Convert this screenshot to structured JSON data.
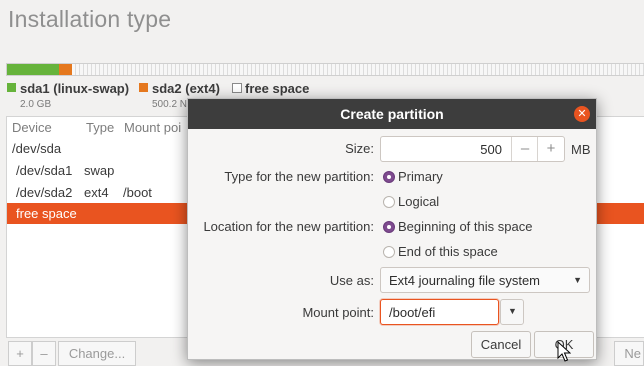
{
  "page_title": "Installation type",
  "disk": {
    "legend": [
      {
        "label": "sda1 (linux-swap)",
        "size": "2.0 GB",
        "color": "#66b33b"
      },
      {
        "label": "sda2 (ext4)",
        "size": "500.2 N",
        "color": "#e5781e"
      },
      {
        "label": "free space",
        "size": "",
        "color": "#ffffff"
      }
    ]
  },
  "table": {
    "headers": {
      "device": "Device",
      "type": "Type",
      "mount": "Mount poi"
    },
    "rows": [
      {
        "device": "/dev/sda",
        "type": "",
        "mount": ""
      },
      {
        "device": "/dev/sda1",
        "type": "swap",
        "mount": ""
      },
      {
        "device": "/dev/sda2",
        "type": "ext4",
        "mount": "/boot"
      },
      {
        "device": "free space",
        "type": "",
        "mount": ""
      }
    ]
  },
  "table_buttons": {
    "add": "+",
    "remove": "–",
    "change": "Change...",
    "new": "Ne"
  },
  "dialog": {
    "title": "Create partition",
    "size_label": "Size:",
    "size_value": "500",
    "size_minus": "–",
    "size_plus": "+",
    "size_unit": "MB",
    "type_label": "Type for the new partition:",
    "type_options": [
      "Primary",
      "Logical"
    ],
    "location_label": "Location for the new partition:",
    "location_options": [
      "Beginning of this space",
      "End of this space"
    ],
    "use_as_label": "Use as:",
    "use_as_value": "Ext4 journaling file system",
    "mount_label": "Mount point:",
    "mount_value": "/boot/efi",
    "cancel": "Cancel",
    "ok": "OK"
  },
  "colors": {
    "accent": "#e95420",
    "titlebar": "#3d3d3d",
    "radio_selected": "#7e4b8f"
  }
}
